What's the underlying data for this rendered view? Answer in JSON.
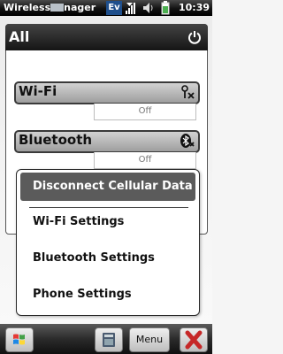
{
  "statusbar": {
    "title_left": "Wireless",
    "title_right": "nager",
    "network_label": "Ev",
    "time": "10:39"
  },
  "panel": {
    "title": "All",
    "devices": [
      {
        "label": "Wi-Fi",
        "status": "Off",
        "icon": "wifi-antenna-icon"
      },
      {
        "label": "Bluetooth",
        "status": "Off",
        "icon": "bluetooth-icon"
      }
    ]
  },
  "menu": {
    "items": [
      {
        "label": "Disconnect Cellular Data",
        "selected": true
      },
      {
        "label": "Wi-Fi Settings"
      },
      {
        "label": "Bluetooth Settings"
      },
      {
        "label": "Phone Settings"
      }
    ]
  },
  "softkeys": {
    "menu_label": "Menu"
  },
  "colors": {
    "bar_dark": "#111111",
    "selected_bg": "#5b5b5b",
    "close_red": "#c62828"
  }
}
